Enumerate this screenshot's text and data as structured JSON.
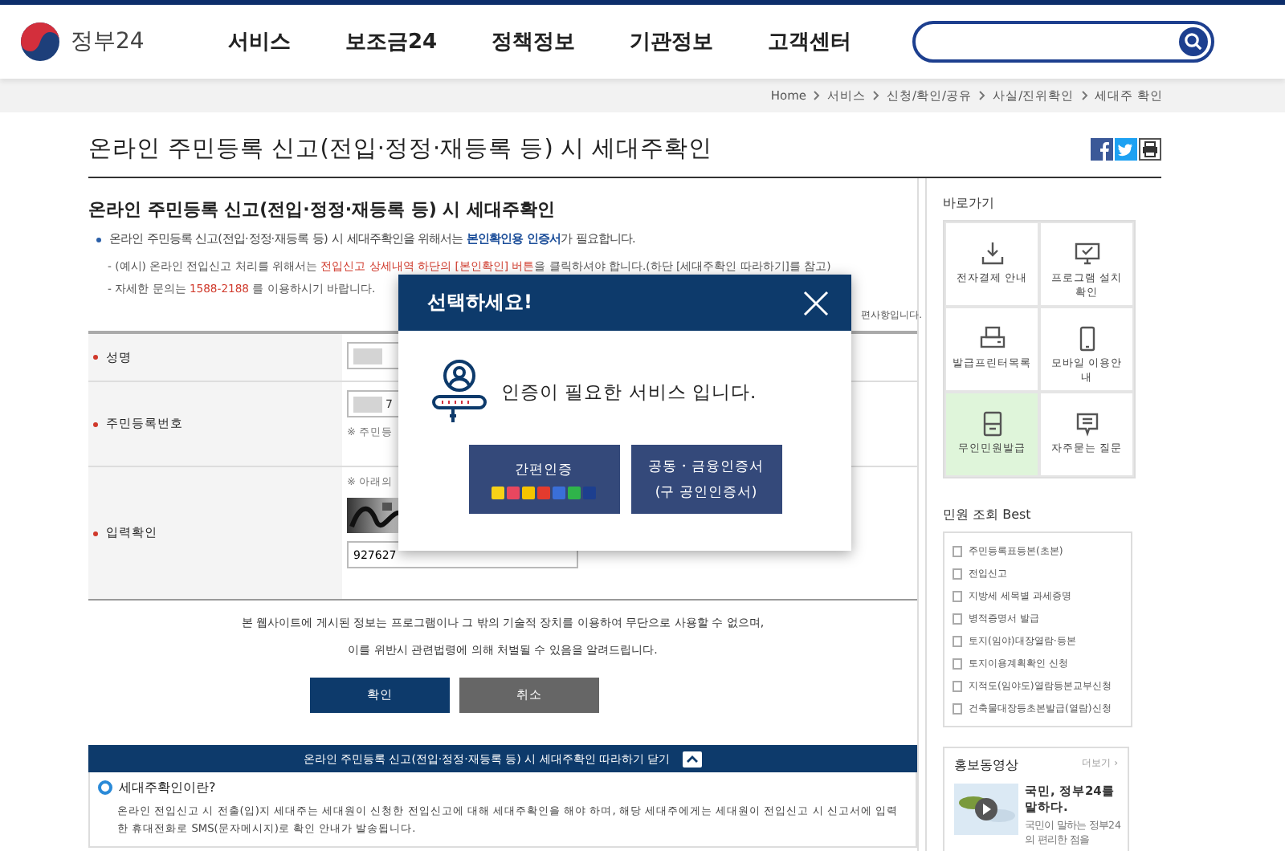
{
  "header": {
    "logo": "정부24",
    "nav": [
      {
        "label": "서비스"
      },
      {
        "label": "보조금24"
      },
      {
        "label": "정책정보"
      },
      {
        "label": "기관정보"
      },
      {
        "label": "고객센터"
      }
    ],
    "search_button": true
  },
  "breadcrumb": [
    "Home",
    "서비스",
    "신청/확인/공유",
    "사실/진위확인",
    "세대주 확인"
  ],
  "page_title": "온라인 주민등록 신고(전입·정정·재등록 등) 시 세대주확인",
  "section_title": "온라인 주민등록 신고(전입·정정·재등록 등) 시 세대주확인",
  "intro": "온라인 주민등록 신고(전입·정정·재등록 등) 시 세대주확인을 위해서는 **본인확인용 인증서**가 필요합니다.",
  "notes": [
    [
      {
        "text": "- (예시) 온라인 전입신고 처리를 위해서는 ",
        "red": false
      },
      {
        "text": "전입신고 상세내역 하단의 [본인확인] 버튼",
        "red": true
      },
      {
        "text": "을 클릭하셔야 합니다.(하단 [세대주확인 따라하기]를 참고)",
        "red": false
      }
    ],
    [
      {
        "text": "- 자세한 문의는 ",
        "red": false
      },
      {
        "text": "1588-2188",
        "red": true
      },
      {
        "text": " 를 이용하시기 바랍니다.",
        "red": false
      }
    ]
  ],
  "required_note_fragment": "편사항입니다.",
  "form": [
    {
      "kind": "name",
      "label": "성명"
    },
    {
      "kind": "resident",
      "label": "주민등록번호",
      "value": "7",
      "hint": "※ 주민등"
    },
    {
      "kind": "captcha",
      "label": "입력확인",
      "hint": "※ 아래의",
      "value": "927627"
    }
  ],
  "notice": [
    "본 웹사이트에 게시된 정보는 프로그램이나 그 밖의 기술적 장치를 이용하여 무단으로 사용할 수 없으며,",
    "이를 위반시 관련법령에 의해 처벌될 수 있음을 알려드립니다."
  ],
  "buttons": [
    {
      "label": "확인",
      "kind": "primary"
    },
    {
      "label": "취소",
      "kind": "secondary"
    }
  ],
  "guide_bar": {
    "label": "온라인 주민등록 신고(전입·정정·재등록 등) 시 세대주확인 따라하기 닫기"
  },
  "guide": {
    "title": "세대주확인이란?",
    "text": "온라인 전입신고 시 전출(입)지 세대주는 세대원이 신청한 전입신고에 대해 세대주확인을 해야 하며, 해당 세대주에게는 세대원이 전입신고 시 신고서에 입력한 휴대전화로 SMS(문자메시지)로 확인 안내가 발송됩니다."
  },
  "sidebar": {
    "shortcuts_title": "바로가기",
    "shortcuts": [
      {
        "kind": "download",
        "label": "전자결제 안내",
        "selected": false
      },
      {
        "kind": "monitor",
        "label": "프로그램 설치 확인",
        "selected": false
      },
      {
        "kind": "printer",
        "label": "발급프린터목록",
        "selected": false
      },
      {
        "kind": "phone",
        "label": "모바일 이용안내",
        "selected": false
      },
      {
        "kind": "kiosk",
        "label": "무인민원발급",
        "selected": true
      },
      {
        "kind": "chat",
        "label": "자주묻는 질문",
        "selected": false
      }
    ],
    "best_title": "민원 조회 Best",
    "best": [
      "주민등록표등본(초본)",
      "전입신고",
      "지방세 세목별 과세증명",
      "병적증명서 발급",
      "토지(임야)대장열람·등본",
      "토지이용계획확인 신청",
      "지적도(임야도)열람등본교부신청",
      "건축물대장등초본발급(열람)신청"
    ],
    "promo": {
      "title": "홍보동영상",
      "more": "더보기 ›",
      "video_title": "국민, 정부24를 말하다.",
      "video_desc": "국민이 말하는 정부24의 편리한 점을"
    }
  },
  "modal": {
    "title": "선택하세요!",
    "message": "인증이 필요한 서비스 입니다.",
    "options": [
      {
        "kind": "simple",
        "lines": [
          "간편인증"
        ]
      },
      {
        "kind": "certificate",
        "lines": [
          "공동・금융인증서",
          "(구 공인인증서)"
        ]
      }
    ]
  }
}
